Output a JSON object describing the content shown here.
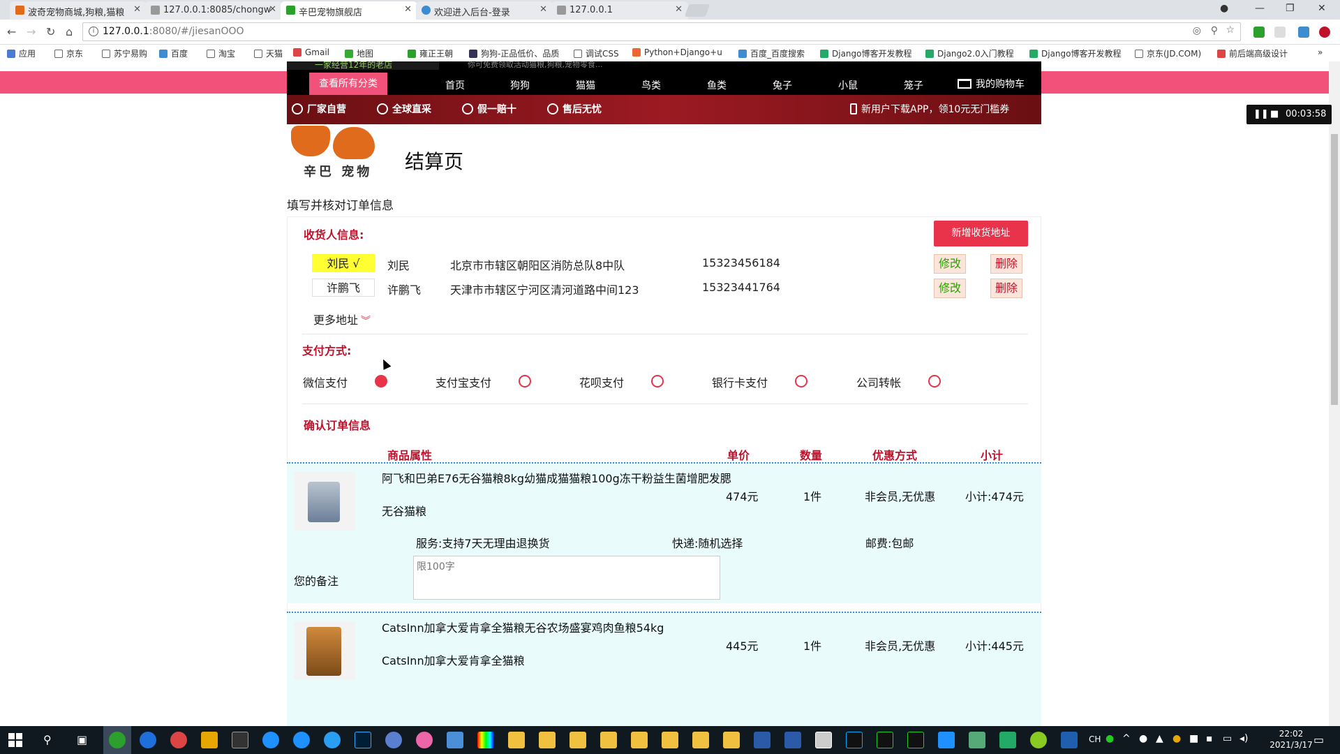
{
  "browser": {
    "tabs": [
      {
        "title": "波奇宠物商城,狗粮,猫粮",
        "icon_color": "#e06b1d"
      },
      {
        "title": "127.0.0.1:8085/chongw",
        "icon_color": "#888888"
      },
      {
        "title": "辛巴宠物旗舰店",
        "icon_color": "#2ca02c"
      },
      {
        "title": "欢迎进入后台-登录",
        "icon_color": "#3d8ccf"
      },
      {
        "title": "127.0.0.1",
        "icon_color": "#888888"
      }
    ],
    "url_host": "127.0.0.1",
    "url_path": ":8080/#/jiesanOOO",
    "bookmarks": [
      "应用",
      "京东",
      "苏宁易购",
      "百度",
      "淘宝",
      "天猫",
      "Gmail",
      "地图",
      "雍正王朝",
      "狗狗-正品低价、品质",
      "调试CSS",
      "Python+Django+u",
      "百度_百度搜索",
      "Django博客开发教程",
      "Django2.0入门教程",
      "Django博客开发教程",
      "京东(JD.COM)",
      "前后端高级设计"
    ]
  },
  "site": {
    "slogan": "一家经营12年的老店",
    "slogan_right": "你可免费领取活动猫粮,狗粮,宠物零食...",
    "all_categories": "查看所有分类",
    "nav": [
      "首页",
      "狗狗",
      "猫猫",
      "鸟类",
      "鱼类",
      "兔子",
      "小鼠",
      "笼子"
    ],
    "cart": "我的购物车",
    "features": [
      "厂家自营",
      "全球直采",
      "假一赔十",
      "售后无忧"
    ],
    "app_promo": "新用户下载APP，领10元无门槛券",
    "logo_text": "辛巴 宠物",
    "page_title": "结算页",
    "subtitle": "填写并核对订单信息"
  },
  "receiver": {
    "label": "收货人信息:",
    "add_button": "新增收货地址",
    "addresses": [
      {
        "tag": "刘民 √",
        "name": "刘民",
        "address": "北京市市辖区朝阳区消防总队8中队",
        "phone": "15323456184",
        "edit": "修改",
        "delete": "删除",
        "selected": true
      },
      {
        "tag": "许鹏飞",
        "name": "许鹏飞",
        "address": "天津市市辖区宁河区清河道路中间123",
        "phone": "15323441764",
        "edit": "修改",
        "delete": "删除",
        "selected": false
      }
    ],
    "more": "更多地址"
  },
  "payment": {
    "label": "支付方式:",
    "options": [
      {
        "name": "微信支付",
        "selected": true
      },
      {
        "name": "支付宝支付",
        "selected": false
      },
      {
        "name": "花呗支付",
        "selected": false
      },
      {
        "name": "银行卡支付",
        "selected": false
      },
      {
        "name": "公司转帐",
        "selected": false
      }
    ]
  },
  "order": {
    "label": "确认订单信息",
    "columns": [
      "商品属性",
      "单价",
      "数量",
      "优惠方式",
      "小计"
    ],
    "items": [
      {
        "name": "阿飞和巴弟E76无谷猫粮8kg幼猫成猫猫粮100g冻干粉益生菌增肥发腮",
        "subtitle": "无谷猫粮",
        "price": "474元",
        "qty": "1件",
        "discount": "非会员,无优惠",
        "subtotal": "小计:474元",
        "service": "服务:支持7天无理由退换货",
        "shipping": "快递:随机选择",
        "postage": "邮费:包邮",
        "note_label": "您的备注",
        "note_placeholder": "限100字"
      },
      {
        "name": "CatsInn加拿大爱肯拿全猫粮无谷农场盛宴鸡肉鱼粮54kg",
        "subtitle": "CatsInn加拿大爱肯拿全猫粮",
        "price": "445元",
        "qty": "1件",
        "discount": "非会员,无优惠",
        "subtotal": "小计:445元"
      }
    ]
  },
  "recorder": {
    "time": "00:03:58"
  },
  "taskbar": {
    "clock_time": "22:02",
    "clock_date": "2021/3/17",
    "ime": "CH"
  },
  "colors": {
    "accent_pink": "#f2527a",
    "accent_red": "#e8334a",
    "label_red": "#c0122b",
    "highlight_yellow": "#ffff33",
    "item_bg": "#e9fbfb"
  }
}
